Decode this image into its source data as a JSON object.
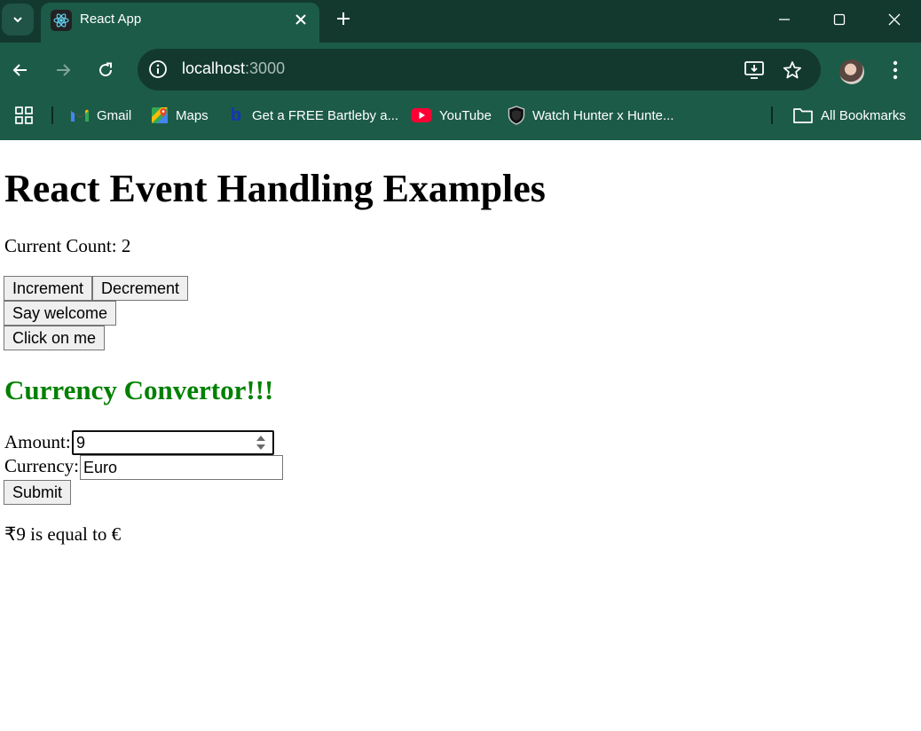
{
  "browser": {
    "tab": {
      "title": "React App"
    },
    "address": {
      "host": "localhost",
      "port": ":3000"
    },
    "bookmarks": [
      {
        "label": "Gmail"
      },
      {
        "label": "Maps"
      },
      {
        "label": "Get a FREE Bartleby a..."
      },
      {
        "label": "YouTube"
      },
      {
        "label": "Watch Hunter x Hunte..."
      }
    ],
    "all_bookmarks": "All Bookmarks"
  },
  "page": {
    "title": "React Event Handling Examples",
    "count_text": "Current Count: 2",
    "buttons": {
      "increment": "Increment",
      "decrement": "Decrement",
      "welcome": "Say welcome",
      "click": "Click on me"
    },
    "converter": {
      "heading": "Currency Convertor!!!",
      "amount_label": "Amount:",
      "amount_value": "9",
      "currency_label": "Currency:",
      "currency_value": "Euro",
      "submit": "Submit",
      "result": "₹9 is equal to €"
    }
  },
  "colors": {
    "chrome": "#1c5b48",
    "tabstrip": "#13392f",
    "heading_green": "#008000"
  }
}
